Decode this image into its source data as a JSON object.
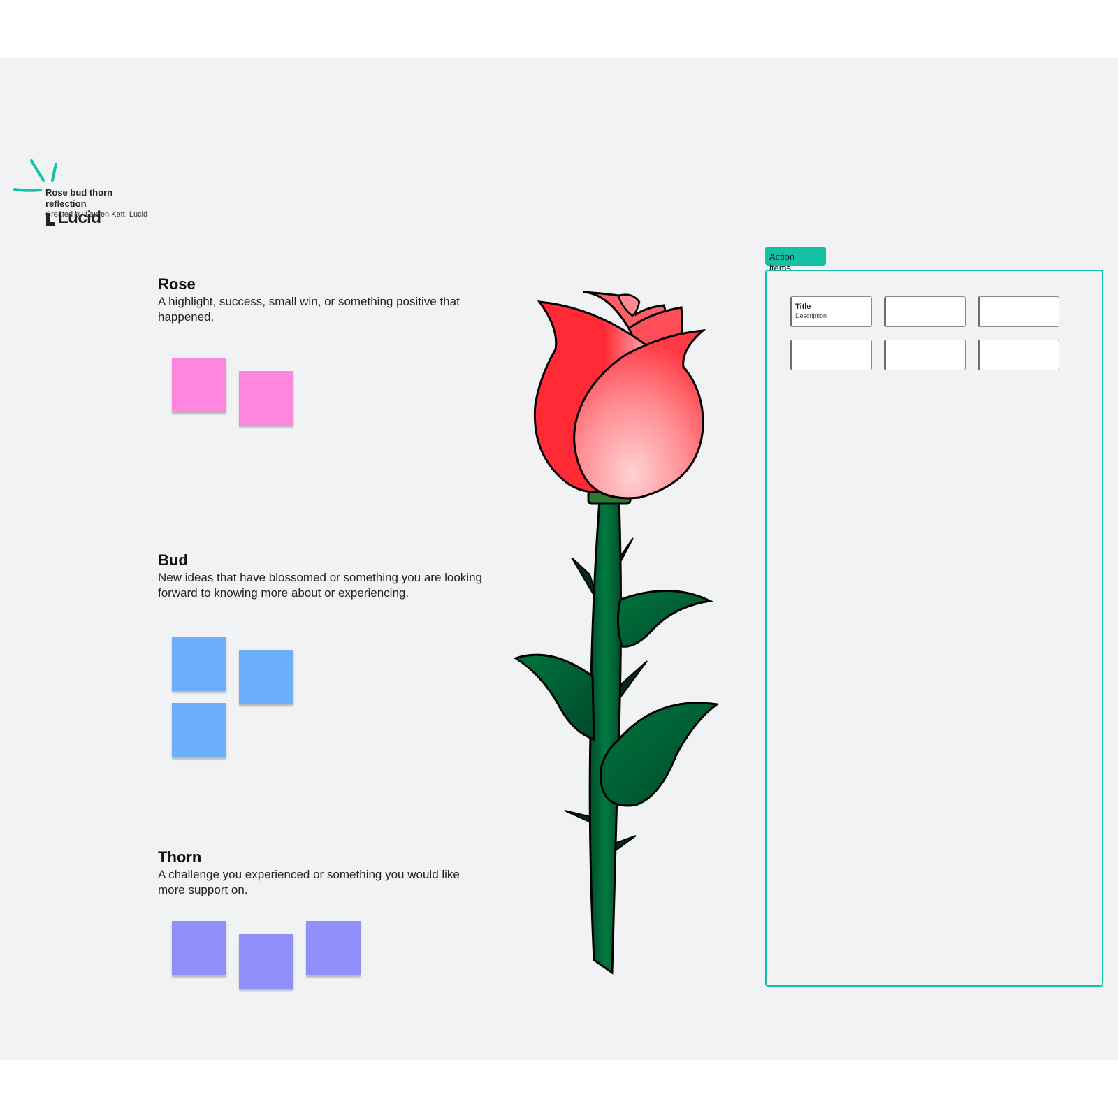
{
  "template": {
    "title": "Rose bud thorn reflection",
    "credit": "Created by Lauren Kett, Lucid",
    "brand": "Lucid"
  },
  "sections": {
    "rose": {
      "title": "Rose",
      "description": "A highlight, success, small win, or something positive that happened.",
      "sticky_count": 2
    },
    "bud": {
      "title": "Bud",
      "description": "New ideas that have blossomed or something you are looking forward to knowing more about or experiencing.",
      "sticky_count": 3
    },
    "thorn": {
      "title": "Thorn",
      "description": "A challenge you experienced or something you would like more support on.",
      "sticky_count": 3
    }
  },
  "action_items": {
    "label": "Action items",
    "cards": [
      {
        "title": "Title",
        "description": "Description"
      },
      {
        "title": "",
        "description": ""
      },
      {
        "title": "",
        "description": ""
      },
      {
        "title": "",
        "description": ""
      },
      {
        "title": "",
        "description": ""
      },
      {
        "title": "",
        "description": ""
      }
    ]
  },
  "colors": {
    "canvas": "#f1f2f4",
    "accent": "#13c2a6",
    "sticky_rose": "#fe86dc",
    "sticky_bud": "#6eaffc",
    "sticky_thorn": "#8f90fa",
    "petal": "#ff2a35",
    "leaf": "#006b38"
  },
  "icons": [
    "sparkle-icon",
    "lucid-logo-icon",
    "rose-illustration"
  ]
}
